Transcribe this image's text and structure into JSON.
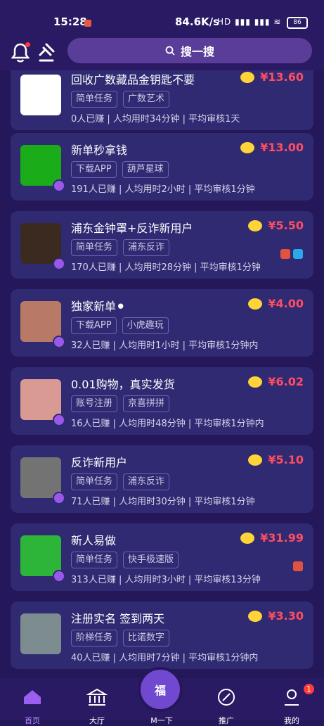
{
  "status_bar": {
    "time": "15:28",
    "net": "84.6K/s",
    "signal": "HD ▮▮▮ ▮▮▮ ≋",
    "battery": "86"
  },
  "header": {
    "search_label": "搜一搜"
  },
  "cards": [
    {
      "title": "回收广数藏品金钥匙不要",
      "price": "¥13.60",
      "tags": [
        "简单任务",
        "广数艺术"
      ],
      "stats": "0人已赚   |   人均用时34分钟   |   平均审核1天",
      "icons": []
    },
    {
      "title": "新单秒拿钱",
      "price": "¥13.00",
      "tags": [
        "下载APP",
        "葫芦星球"
      ],
      "stats": "191人已赚   |   人均用时2小时   |   平均审核1分钟",
      "icons": []
    },
    {
      "title": "浦东金钟罩+反诈新用户",
      "price": "¥5.50",
      "tags": [
        "简单任务",
        "浦东反诈"
      ],
      "stats": "170人已赚   |   人均用时28分钟   |   平均审核1分钟",
      "icons": [
        "#e2533f",
        "#2aa8e8"
      ]
    },
    {
      "title": "独家新单⚫",
      "price": "¥4.00",
      "tags": [
        "下载APP",
        "小虎趣玩"
      ],
      "stats": "32人已赚   |   人均用时1小时   |   平均审核1分钟内",
      "icons": []
    },
    {
      "title": "0.01购物，真实发货",
      "price": "¥6.02",
      "tags": [
        "账号注册",
        "京喜拼拼"
      ],
      "stats": "16人已赚   |   人均用时48分钟   |   平均审核1分钟内",
      "icons": []
    },
    {
      "title": "反诈新用户",
      "price": "¥5.10",
      "tags": [
        "简单任务",
        "浦东反诈"
      ],
      "stats": "71人已赚   |   人均用时30分钟   |   平均审核1分钟",
      "icons": []
    },
    {
      "title": "新人易做",
      "price": "¥31.99",
      "tags": [
        "简单任务",
        "快手极速版"
      ],
      "stats": "313人已赚   |   人均用时3小时   |   平均审核13分钟",
      "icons": [
        "#e2533f"
      ]
    },
    {
      "title": "注册实名 签到两天",
      "price": "¥3.30",
      "tags": [
        "阶梯任务",
        "比诺数字"
      ],
      "stats": "40人已赚   |   人均用时7分钟   |   平均审核1分钟内",
      "icons": []
    }
  ],
  "nav": {
    "home": "首页",
    "hall": "大厅",
    "mid": "M一下",
    "promote": "推广",
    "mine": "我的",
    "mine_badge": "1",
    "mid_icon_char": "福"
  }
}
